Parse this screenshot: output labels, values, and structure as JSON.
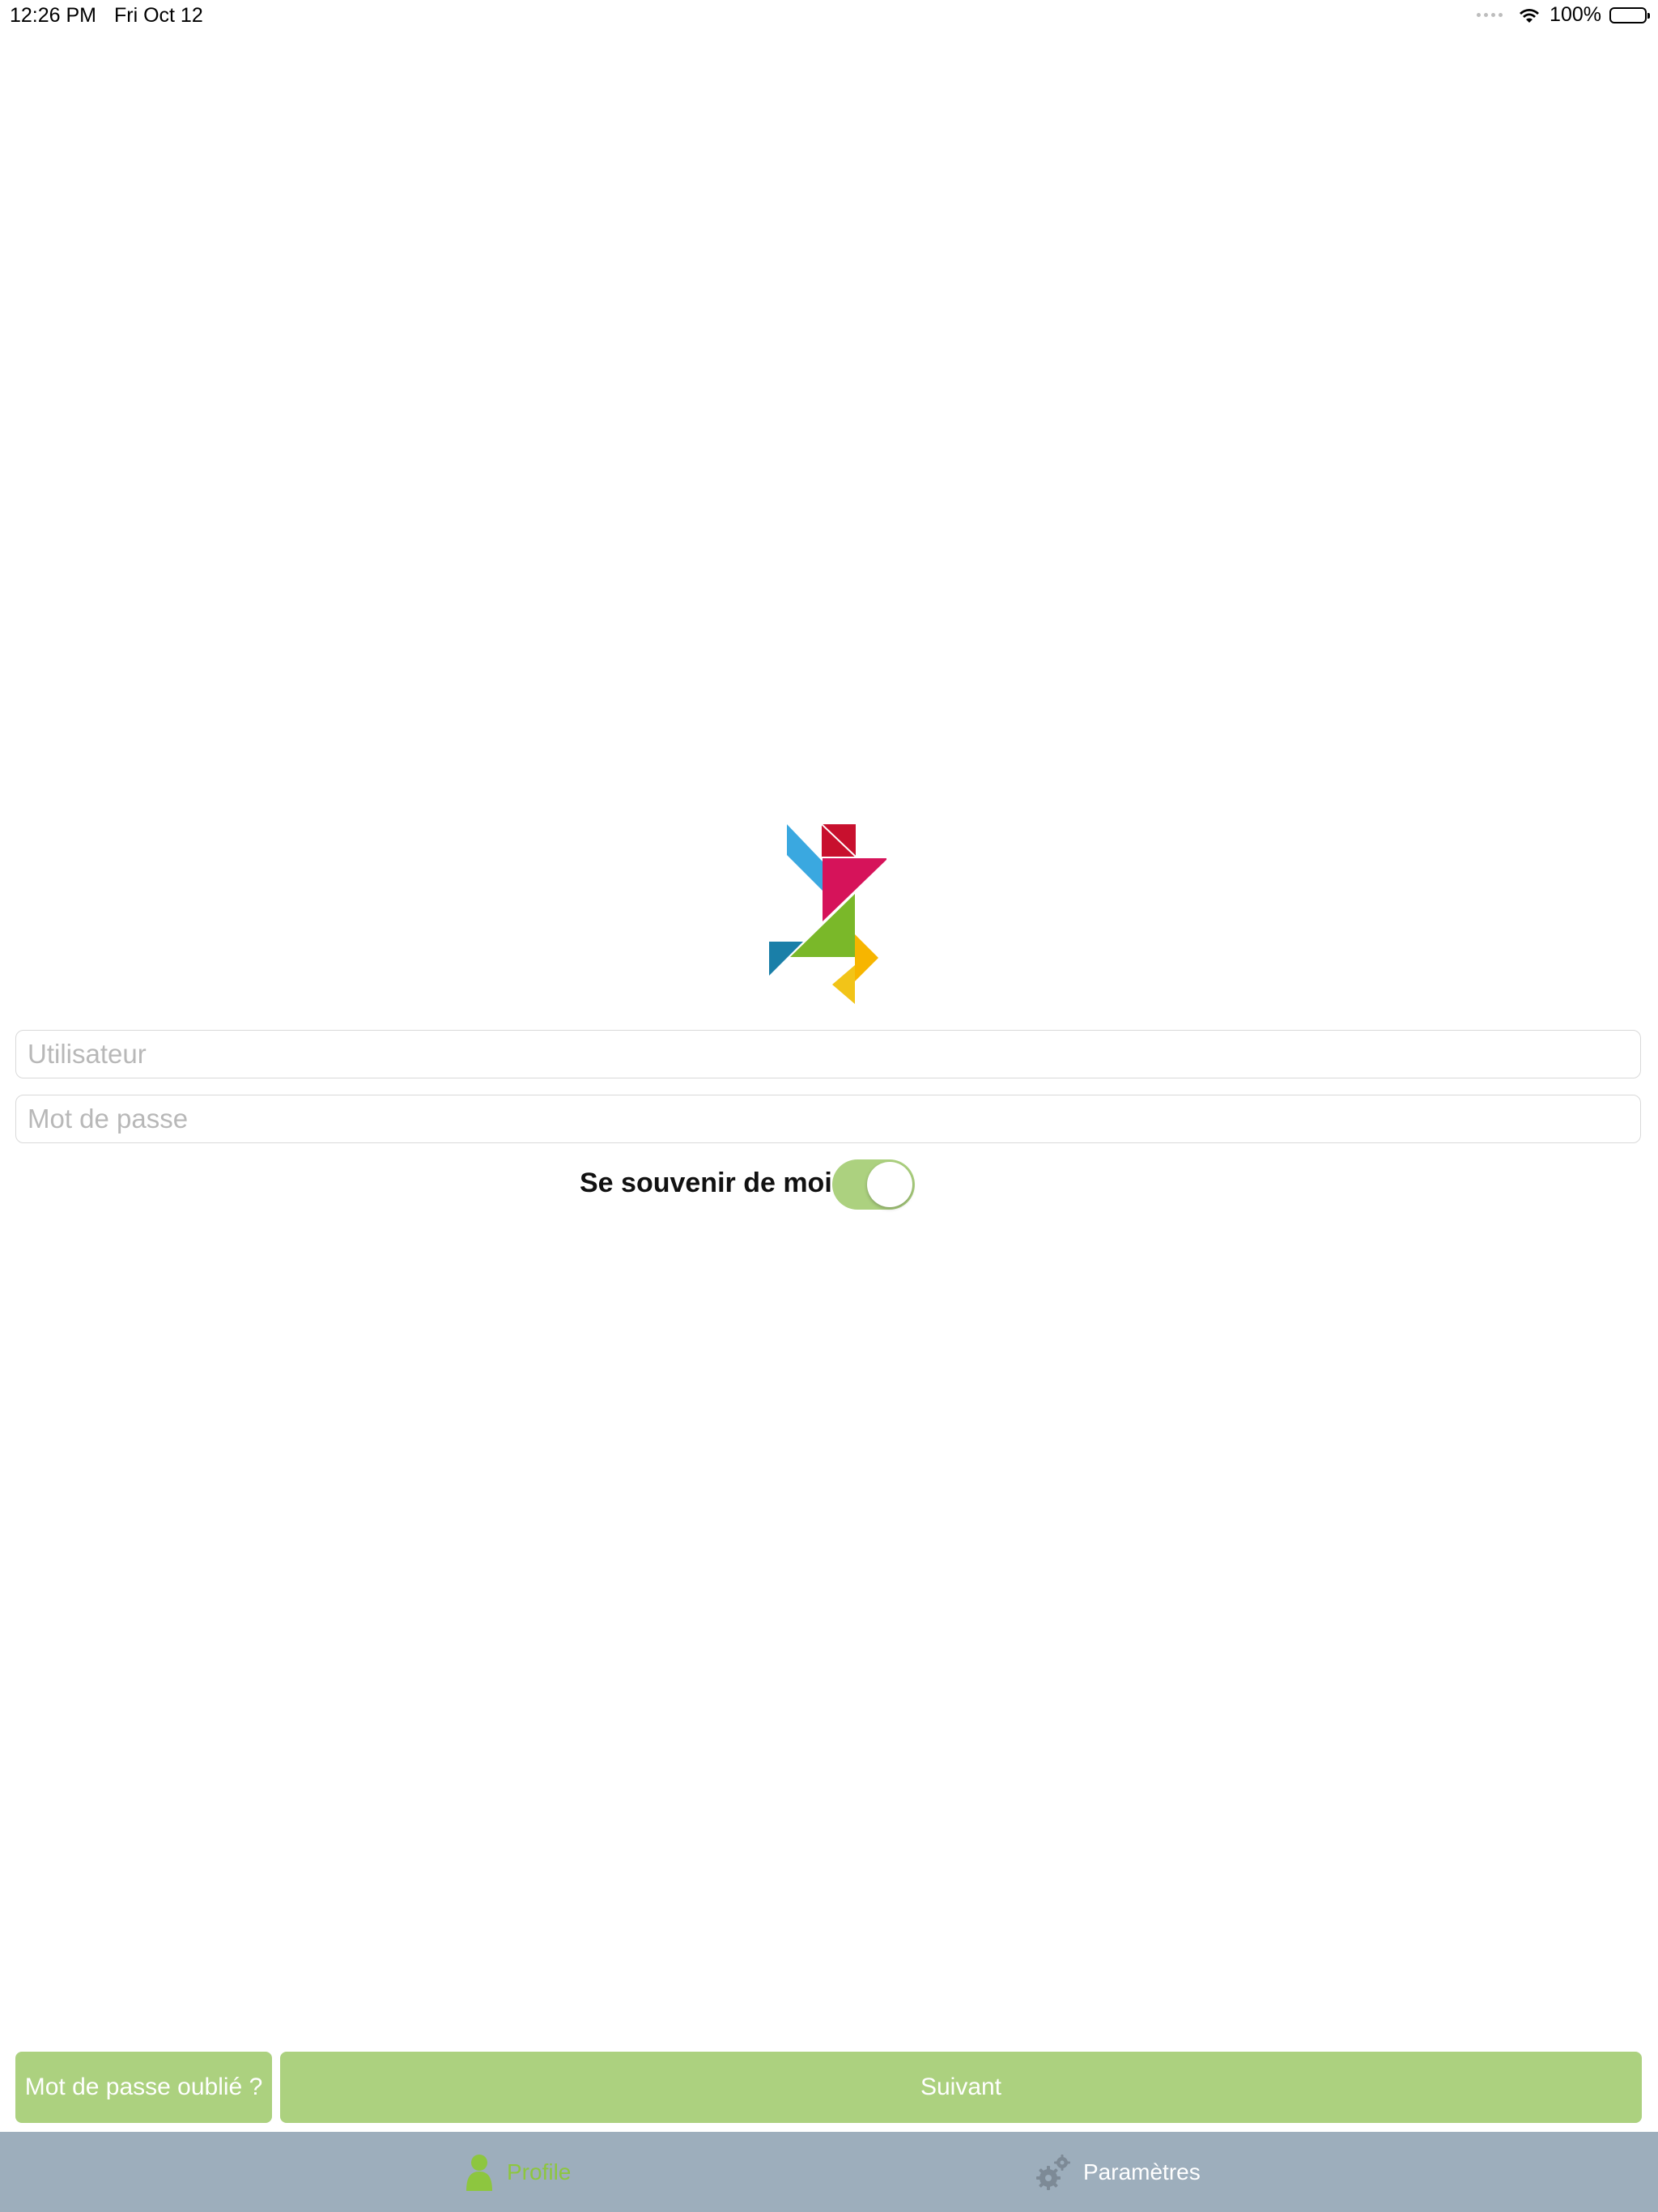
{
  "status_bar": {
    "time": "12:26 PM",
    "date": "Fri Oct 12",
    "battery_text": "100%"
  },
  "login": {
    "username_placeholder": "Utilisateur",
    "password_placeholder": "Mot de passe",
    "remember_label": "Se souvenir de moi",
    "remember_on": true
  },
  "actions": {
    "forgot_label": "Mot de passe oublié ?",
    "next_label": "Suivant"
  },
  "tab_bar": {
    "items": [
      {
        "label": "Profile",
        "icon": "person-icon",
        "selected": true
      },
      {
        "label": "Paramètres",
        "icon": "gears-icon",
        "selected": false
      }
    ]
  },
  "colors": {
    "accent_green": "#acd17f",
    "tab_selected_green": "#8dc63f",
    "tab_bar_bg": "#9daebc"
  }
}
